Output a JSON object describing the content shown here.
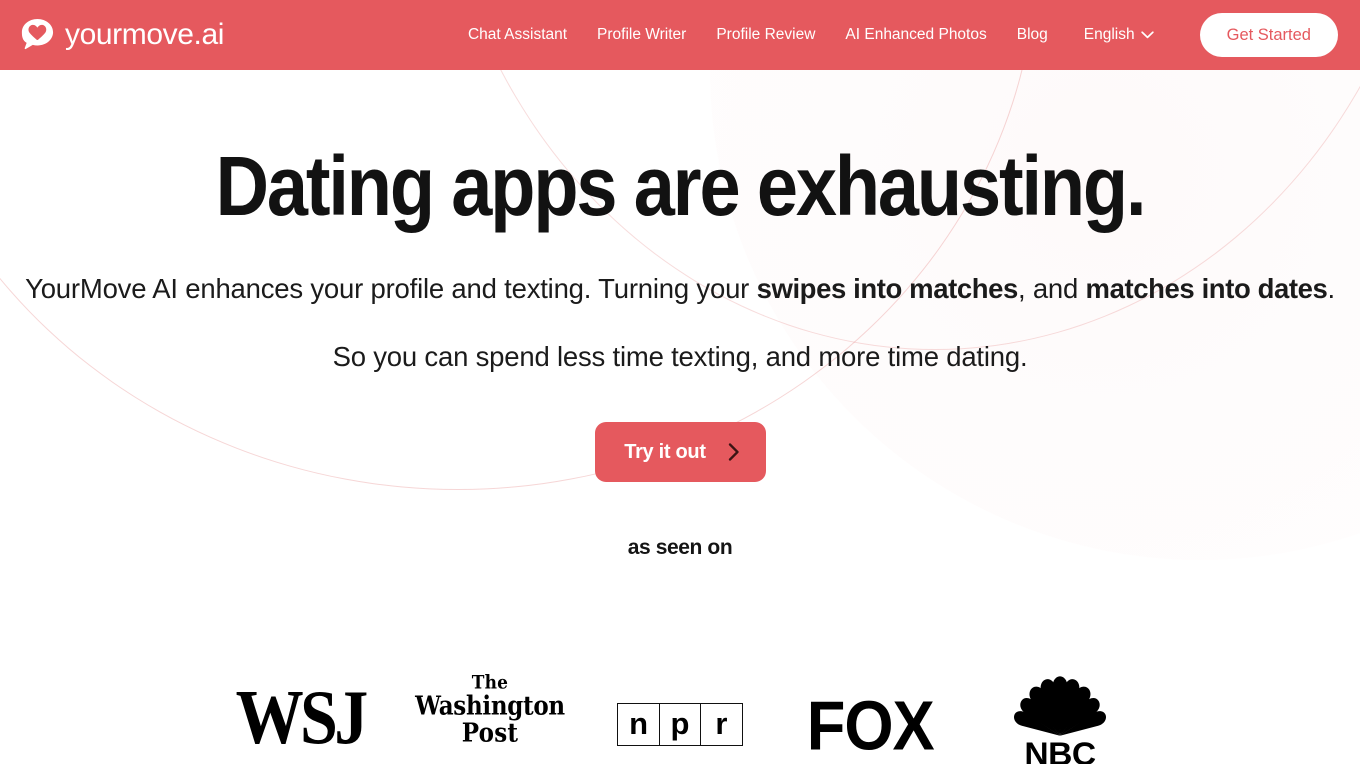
{
  "brand": {
    "name": "yourmove.ai",
    "logo_icon": "speech-bubble-heart-icon"
  },
  "colors": {
    "accent": "#e5595e",
    "header_bg": "#e5595e",
    "page_bg": "#ffffff",
    "text": "#121212",
    "cta_text": "#ffffff",
    "decor_line": "#e27878"
  },
  "header": {
    "nav_items": [
      {
        "label": "Chat Assistant"
      },
      {
        "label": "Profile Writer"
      },
      {
        "label": "Profile Review"
      },
      {
        "label": "AI Enhanced Photos"
      },
      {
        "label": "Blog"
      }
    ],
    "language": {
      "selected": "English",
      "icon": "chevron-down-icon"
    },
    "get_started_label": "Get Started"
  },
  "hero": {
    "headline": "Dating apps are exhausting.",
    "subtitle": {
      "part1": "YourMove AI enhances your profile and texting. Turning your ",
      "bold1": "swipes into matches",
      "part2": ", and ",
      "bold2": "matches into dates",
      "part3": "."
    },
    "tagline": "So you can spend less time texting, and more time dating.",
    "cta": {
      "label": "Try it out",
      "icon": "chevron-right-icon"
    }
  },
  "social_proof": {
    "heading": "as seen on",
    "logos": [
      {
        "name": "wsj",
        "text": "WSJ"
      },
      {
        "name": "washington-post",
        "line1": "The",
        "line2": "Washington",
        "line3": "Post"
      },
      {
        "name": "npr",
        "letters": [
          "n",
          "p",
          "r"
        ]
      },
      {
        "name": "fox",
        "text": "FOX"
      },
      {
        "name": "nbc",
        "text": "NBC"
      }
    ]
  }
}
